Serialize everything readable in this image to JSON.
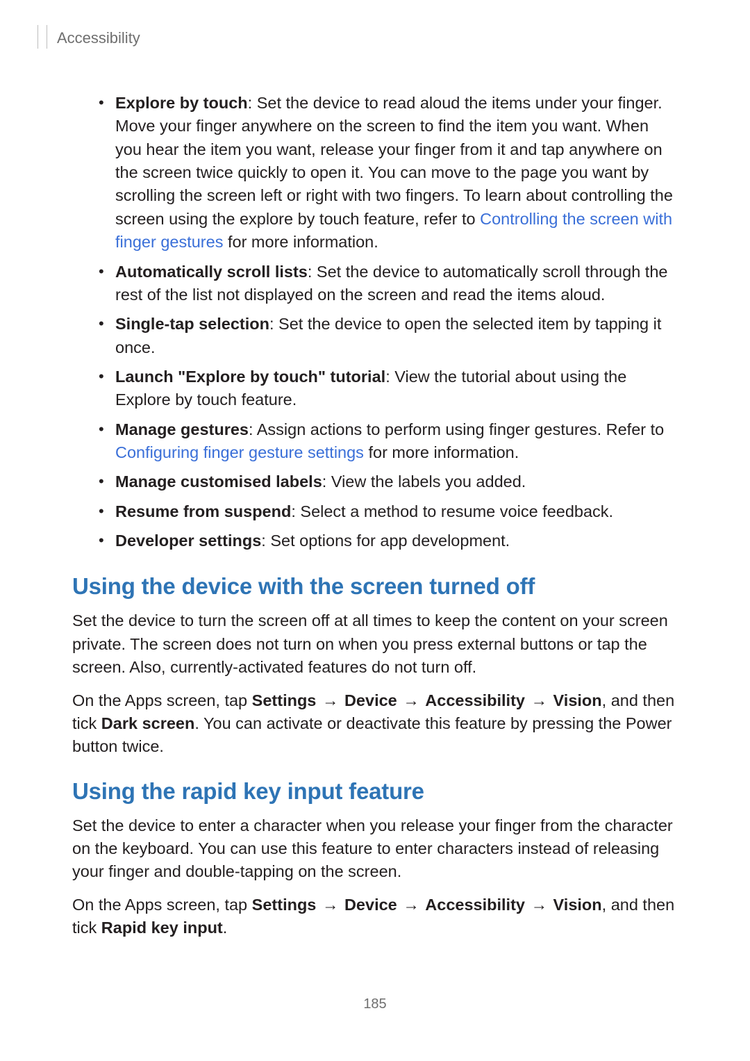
{
  "header": {
    "title": "Accessibility"
  },
  "bullets": [
    {
      "bold": "Explore by touch",
      "text": ": Set the device to read aloud the items under your finger. Move your finger anywhere on the screen to find the item you want. When you hear the item you want, release your finger from it and tap anywhere on the screen twice quickly to open it. You can move to the page you want by scrolling the screen left or right with two fingers. To learn about controlling the screen using the explore by touch feature, refer to ",
      "link": "Controlling the screen with finger gestures",
      "after_link": " for more information."
    },
    {
      "bold": "Automatically scroll lists",
      "text": ": Set the device to automatically scroll through the rest of the list not displayed on the screen and read the items aloud."
    },
    {
      "bold": "Single-tap selection",
      "text": ": Set the device to open the selected item by tapping it once."
    },
    {
      "bold": "Launch \"Explore by touch\" tutorial",
      "text": ": View the tutorial about using the Explore by touch feature."
    },
    {
      "bold": "Manage gestures",
      "text": ": Assign actions to perform using finger gestures. Refer to ",
      "link": "Configuring finger gesture settings",
      "after_link": " for more information."
    },
    {
      "bold": "Manage customised labels",
      "text": ": View the labels you added."
    },
    {
      "bold": "Resume from suspend",
      "text": ": Select a method to resume voice feedback."
    },
    {
      "bold": "Developer settings",
      "text": ": Set options for app development."
    }
  ],
  "section1": {
    "heading": "Using the device with the screen turned off",
    "p1": "Set the device to turn the screen off at all times to keep the content on your screen private. The screen does not turn on when you press external buttons or tap the screen. Also, currently-activated features do not turn off.",
    "p2_pre": "On the Apps screen, tap ",
    "nav": {
      "s1": "Settings",
      "s2": "Device",
      "s3": "Accessibility",
      "s4": "Vision"
    },
    "p2_mid": ", and then tick ",
    "p2_bold": "Dark screen",
    "p2_post": ". You can activate or deactivate this feature by pressing the Power button twice."
  },
  "section2": {
    "heading": "Using the rapid key input feature",
    "p1": "Set the device to enter a character when you release your finger from the character on the keyboard. You can use this feature to enter characters instead of releasing your finger and double-tapping on the screen.",
    "p2_pre": "On the Apps screen, tap ",
    "nav": {
      "s1": "Settings",
      "s2": "Device",
      "s3": "Accessibility",
      "s4": "Vision"
    },
    "p2_mid": ", and then tick ",
    "p2_bold": "Rapid key input",
    "p2_post": "."
  },
  "arrow": "→",
  "pagenum": "185"
}
